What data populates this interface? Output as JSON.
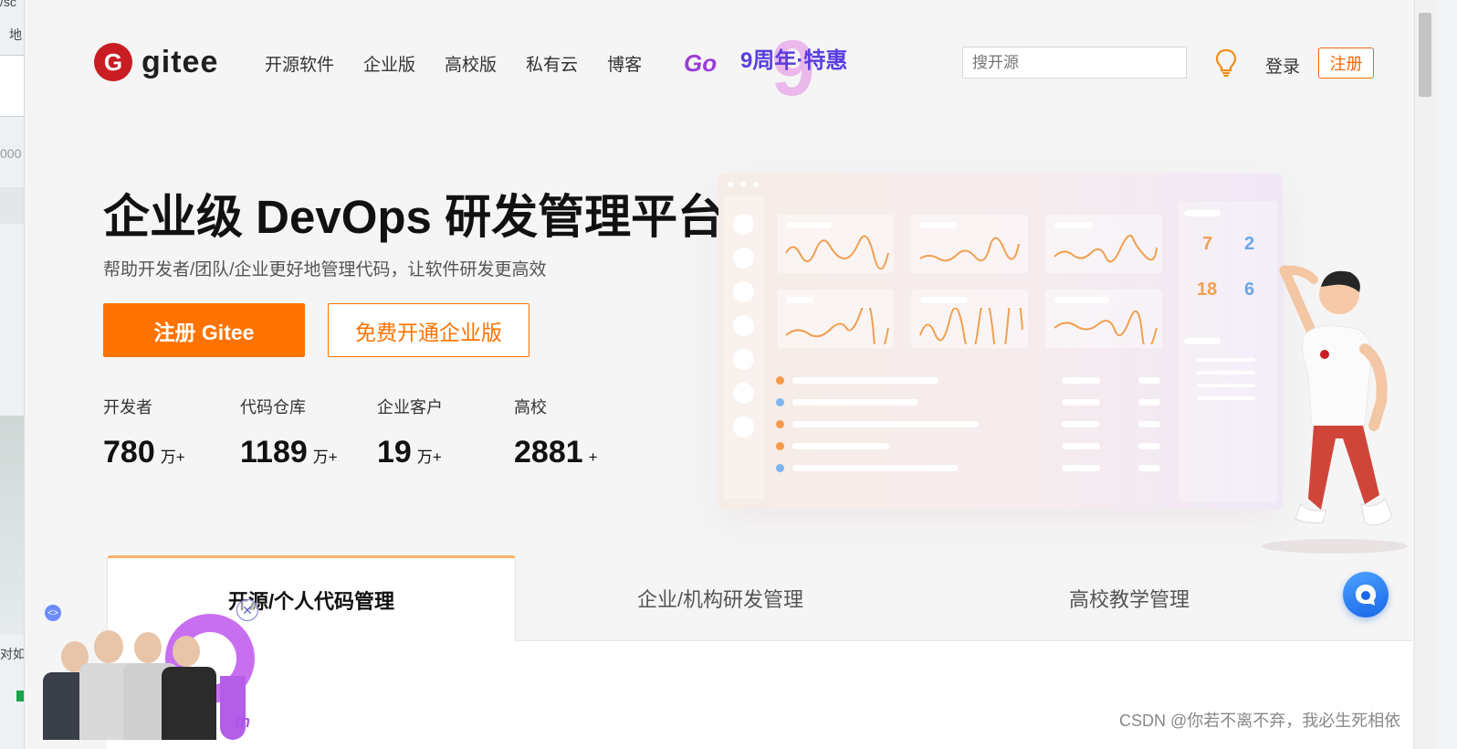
{
  "left_window": {
    "fragments": [
      "/sc",
      "地",
      "000",
      "对如"
    ]
  },
  "header": {
    "logo_text": "gitee",
    "logo_mark": "G",
    "nav": [
      "开源软件",
      "企业版",
      "高校版",
      "私有云",
      "博客"
    ],
    "go_label": "Go",
    "anniversary": "9周年·特惠",
    "search_placeholder": "搜开源",
    "login": "登录",
    "register": "注册"
  },
  "hero": {
    "title": "企业级 DevOps 研发管理平台",
    "subtitle": "帮助开发者/团队/企业更好地管理代码，让软件研发更高效",
    "primary_button": "注册 Gitee",
    "secondary_button": "免费开通企业版"
  },
  "stats": [
    {
      "label": "开发者",
      "value": "780",
      "unit": "万+"
    },
    {
      "label": "代码仓库",
      "value": "1189",
      "unit": "万+"
    },
    {
      "label": "企业客户",
      "value": "19",
      "unit": "万+"
    },
    {
      "label": "高校",
      "value": "2881",
      "unit": "+"
    }
  ],
  "illustration": {
    "calendar_numbers": [
      "7",
      "2",
      "18",
      "6"
    ]
  },
  "tabs": [
    {
      "label": "开源/个人代码管理",
      "active": true
    },
    {
      "label": "企业/机构研发管理",
      "active": false
    },
    {
      "label": "高校教学管理",
      "active": false
    }
  ],
  "promo": {
    "badge": "th"
  },
  "watermark": "CSDN @你若不离不弃，我必生死相依",
  "colors": {
    "brand": "#c71d23",
    "accent": "#fe7300",
    "tab_highlight": "#fab16b"
  }
}
